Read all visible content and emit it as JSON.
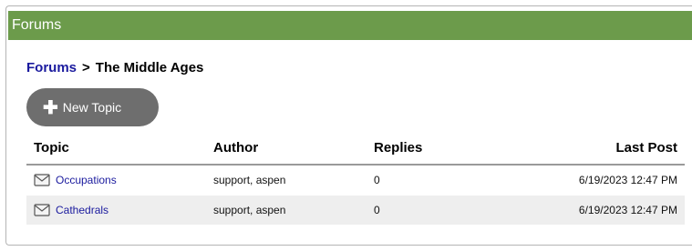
{
  "panel": {
    "title": "Forums"
  },
  "breadcrumb": {
    "root": "Forums",
    "separator": ">",
    "current": "The Middle Ages"
  },
  "toolbar": {
    "new_topic_label": "New Topic"
  },
  "table": {
    "headers": {
      "topic": "Topic",
      "author": "Author",
      "replies": "Replies",
      "last_post": "Last Post"
    },
    "rows": [
      {
        "topic": "Occupations",
        "author": "support, aspen",
        "replies": "0",
        "last_post": "6/19/2023 12:47 PM"
      },
      {
        "topic": "Cathedrals",
        "author": "support, aspen",
        "replies": "0",
        "last_post": "6/19/2023 12:47 PM"
      }
    ]
  },
  "colors": {
    "header_green": "#6c9b4b",
    "link_blue": "#1a1a9e",
    "button_gray": "#6e6e6e"
  },
  "icons": {
    "topic": "envelope-icon",
    "new_topic": "plus-icon"
  }
}
